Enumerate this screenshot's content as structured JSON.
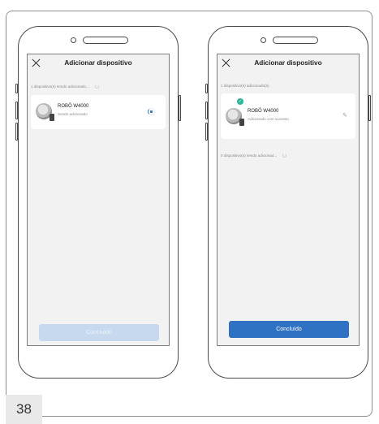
{
  "page_number": "38",
  "screens": [
    {
      "title": "Adicionar dispositivo",
      "status_text": "1 dispositivo(s) sendo adicionado...",
      "device": {
        "name": "ROBÔ W4000",
        "status": "Sendo adicionado"
      },
      "button_label": "Concluído"
    },
    {
      "title": "Adicionar dispositivo",
      "status_text": "1 dispositivo(s) adicionado(s)",
      "device": {
        "name": "ROBÔ W4000",
        "status": "Adicionado com sucesso"
      },
      "pending_text": "0 dispositivo(s) sendo adicionad...",
      "button_label": "Concluído"
    }
  ],
  "icons": {
    "close": "close-icon",
    "spinner": "loading-spinner-icon",
    "check": "success-check-icon",
    "edit": "edit-pencil-icon"
  },
  "colors": {
    "primary": "#2f72c4",
    "disabled": "#c6d9ee",
    "success": "#27b89a",
    "screen_bg": "#f2f2f2"
  }
}
